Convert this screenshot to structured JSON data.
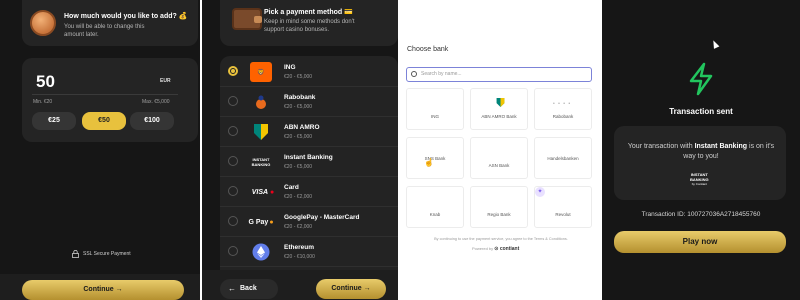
{
  "amount_screen": {
    "title": "How much would you like to add? 💰",
    "subtitle": "You will be able to change this amount later.",
    "amount": "50",
    "currency": "EUR",
    "min": "Min. €20",
    "max": "Max. €5,000",
    "chips": [
      "€25",
      "€50",
      "€100"
    ],
    "selected_chip": "€50",
    "ssl": "SSL Secure Payment",
    "continue": "Continue →"
  },
  "payment_screen": {
    "title": "Pick a payment method 💳",
    "subtitle": "Keep in mind some methods don't support casino bonuses.",
    "methods": [
      {
        "name": "ING",
        "range": "€20 - €5,000",
        "selected": true,
        "logo_text": "ING",
        "logo_color": "#ff6200"
      },
      {
        "name": "Rabobank",
        "range": "€20 - €5,000",
        "selected": false,
        "logo_text": "",
        "logo_color": "#0a2a84"
      },
      {
        "name": "ABN AMRO",
        "range": "€20 - €5,000",
        "selected": false,
        "logo_text": "",
        "logo_color": "#00857a"
      },
      {
        "name": "Instant Banking",
        "range": "€20 - €5,000",
        "selected": false,
        "logo_text": "INSTANT BANKING",
        "logo_color": "#ffffff"
      },
      {
        "name": "Card",
        "range": "€20 - €2,000",
        "selected": false,
        "logo_text": "VISA",
        "logo_color": "#ffffff"
      },
      {
        "name": "GooglePay - MasterCard",
        "range": "€20 - €2,000",
        "selected": false,
        "logo_text": "G Pay",
        "logo_color": "#ffffff"
      },
      {
        "name": "Ethereum",
        "range": "€20 - €10,000",
        "selected": false,
        "logo_text": "",
        "logo_color": "#627eea"
      }
    ],
    "back": "Back",
    "continue": "Continue →"
  },
  "bank_screen": {
    "title": "Choose bank",
    "search_placeholder": "Search by name...",
    "tiles": [
      "ING",
      "ABN AMRO Bank",
      "Rabobank",
      "SNS Bank",
      "ASN Bank",
      "Handelsbanken",
      "Knab",
      "Regio Bank",
      "Revolut"
    ],
    "consent": "By continuing to use the payment service, you agree to the Terms & Conditions.",
    "powered_label": "Powered by",
    "powered_brand": "⊙ contiant"
  },
  "sent_screen": {
    "title": "Transaction sent",
    "msg_pre": "Your transaction with",
    "msg_brand": "Instant Banking",
    "msg_post": "is on it's way to you!",
    "logo_line1": "INSTANT",
    "logo_line2": "BANKING",
    "logo_line3": "by Contiant",
    "tx_id": "Transaction ID: 100727036A2718455760",
    "play": "Play now",
    "accent": "#22c55e"
  }
}
